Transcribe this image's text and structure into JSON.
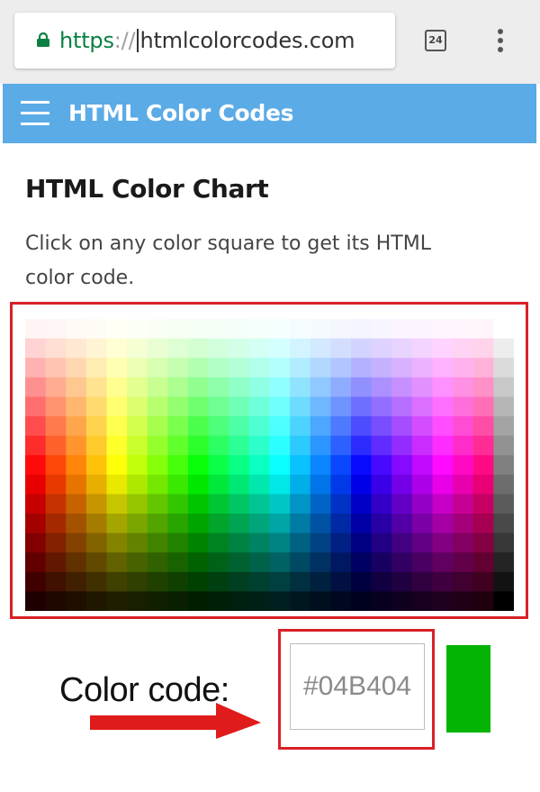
{
  "browser": {
    "url_scheme": "https",
    "url_separator": "://",
    "url_host": "htmlcolorcodes.com",
    "tab_count": "24",
    "icons": {
      "lock": "lock-icon",
      "tabs": "tab-switcher-icon",
      "menu": "overflow-menu-icon"
    }
  },
  "site": {
    "title": "HTML Color Codes",
    "header_color": "#5aabe6",
    "icons": {
      "menu": "hamburger-menu-icon"
    }
  },
  "page": {
    "title": "HTML Color Chart",
    "intro": "Click on any color square to get its HTML color code."
  },
  "color_chart": {
    "columns": 24,
    "rows": 15,
    "grayscale_column": true
  },
  "color_code": {
    "label": "Color code:",
    "value": "#04B404",
    "swatch_color": "#04B404",
    "highlight_color": "#d92027",
    "arrow_color": "#e01b1b"
  }
}
